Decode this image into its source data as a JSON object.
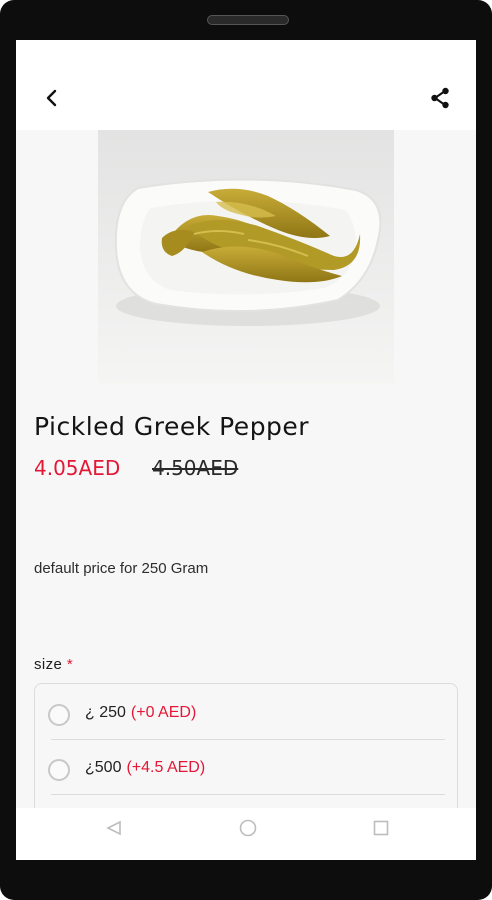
{
  "product": {
    "title": "Pickled Greek Pepper",
    "price": "4.05AED",
    "old_price": "4.50AED",
    "description": "default price for 250 Gram"
  },
  "options_group": {
    "label": "size",
    "required_mark": "*",
    "options": [
      {
        "name": "¿ 250",
        "price": "(+0 AED)",
        "selected": false
      },
      {
        "name": "¿500",
        "price": "(+4.5 AED)",
        "selected": false
      }
    ]
  },
  "icons": {
    "back": "chevron-left-icon",
    "share": "share-icon",
    "nav_back": "back-triangle-icon",
    "nav_home": "home-circle-icon",
    "nav_recent": "recent-apps-icon"
  },
  "colors": {
    "accent": "#e31837",
    "page_background": "#f7f7f7",
    "device_frame": "#0d0d0d"
  }
}
